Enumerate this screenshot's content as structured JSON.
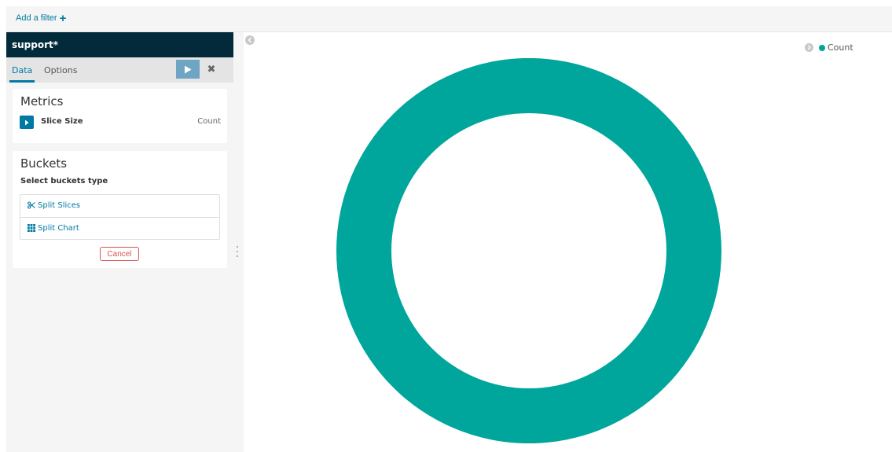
{
  "filter_bar": {
    "add_filter_label": "Add a filter"
  },
  "sidebar": {
    "index_pattern": "support*",
    "tabs": [
      {
        "label": "Data",
        "active": true
      },
      {
        "label": "Options",
        "active": false
      }
    ]
  },
  "metrics": {
    "title": "Metrics",
    "items": [
      {
        "title": "Slice Size",
        "description": "Count"
      }
    ]
  },
  "buckets": {
    "title": "Buckets",
    "subtitle": "Select buckets type",
    "options": [
      {
        "label": "Split Slices",
        "icon": "scissors-icon"
      },
      {
        "label": "Split Chart",
        "icon": "grid-icon"
      }
    ],
    "cancel_label": "Cancel"
  },
  "legend": {
    "items": [
      {
        "label": "Count",
        "color": "#00a69b"
      }
    ]
  },
  "colors": {
    "accent": "#0079a5",
    "header_bg": "#022a3b",
    "danger": "#d9534f",
    "slice": "#00a69b"
  },
  "chart_data": {
    "type": "pie",
    "donut": true,
    "categories": [
      "Count"
    ],
    "values": [
      1
    ],
    "legend_position": "top-right"
  }
}
